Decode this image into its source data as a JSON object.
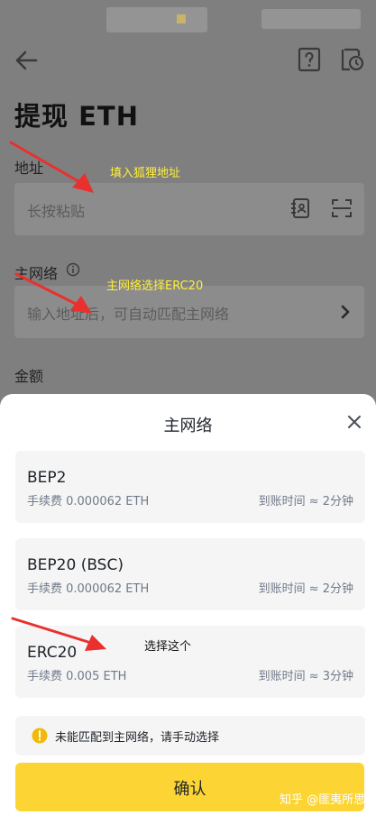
{
  "header": {
    "title": "提现 ETH"
  },
  "form": {
    "address_label": "地址",
    "address_placeholder": "长按粘贴",
    "network_label": "主网络",
    "network_placeholder": "输入地址后，可自动匹配主网络",
    "amount_label": "金额"
  },
  "annotations": {
    "address_note": "填入狐狸地址",
    "network_note": "主网络选择ERC20",
    "select_note": "选择这个"
  },
  "sheet": {
    "title": "主网络",
    "options": [
      {
        "name": "BEP2",
        "fee": "手续费 0.000062 ETH",
        "time": "到账时间 ≈ 2分钟"
      },
      {
        "name": "BEP20 (BSC)",
        "fee": "手续费 0.000062 ETH",
        "time": "到账时间 ≈ 2分钟"
      },
      {
        "name": "ERC20",
        "fee": "手续费 0.005 ETH",
        "time": "到账时间 ≈ 3分钟"
      }
    ],
    "warning": "未能匹配到主网络，请手动选择",
    "confirm_label": "确认"
  },
  "watermark": "知乎 @匪夷所思",
  "colors": {
    "accent": "#fcd535",
    "warning": "#f0b90b",
    "annotation_arrow": "#e8312f"
  }
}
